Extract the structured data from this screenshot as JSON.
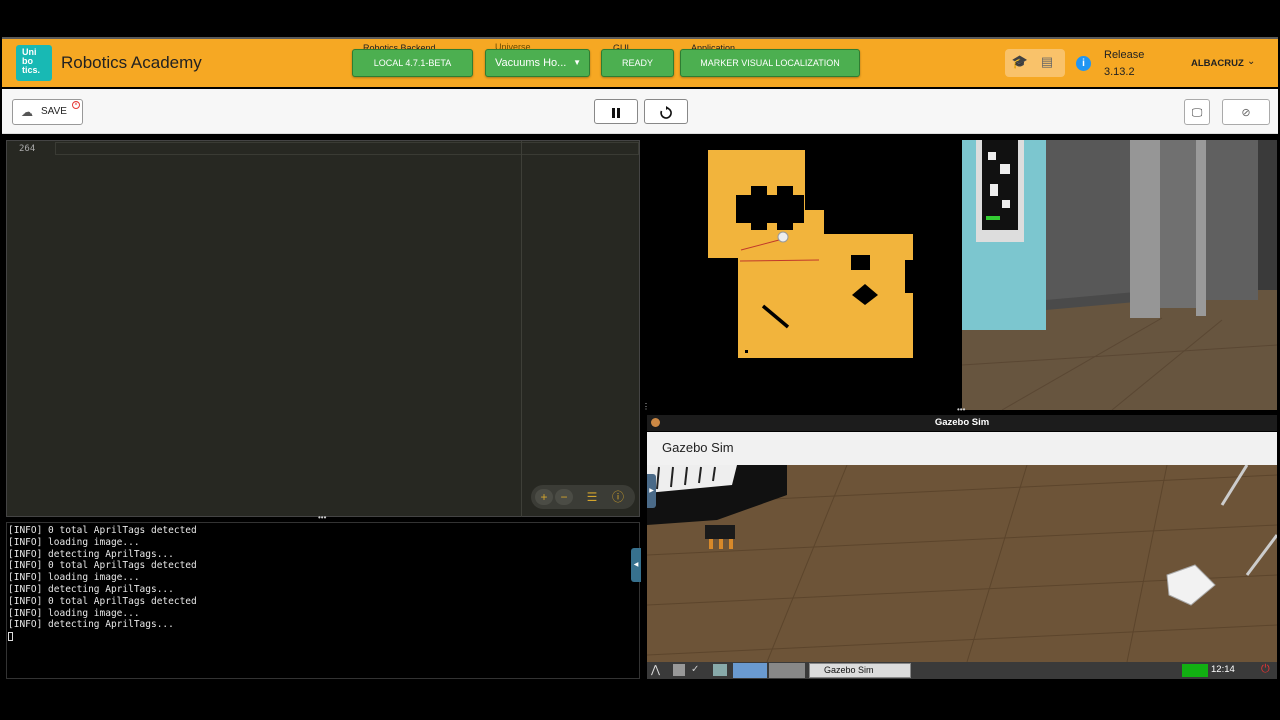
{
  "header": {
    "logo_lines": [
      "Uni",
      "bo",
      "tics."
    ],
    "app_title": "Robotics Academy",
    "backend_caption": "Robotics Backend",
    "backend_value": "LOCAL 4.7.1-BETA",
    "universe_caption": "Universe",
    "universe_value": "Vacuums Ho...",
    "gui_caption": "GUI",
    "gui_value": "READY",
    "application_caption": "Application",
    "application_value": "MARKER VISUAL LOCALIZATION",
    "release_label": "Release",
    "release_version": "3.13.2",
    "user_name": "ALBACRUZ"
  },
  "toolbar": {
    "save_label": "SAVE"
  },
  "editor": {
    "line_number": "264"
  },
  "console": {
    "lines": [
      "[INFO] 0 total AprilTags detected",
      "[INFO] loading image...",
      "[INFO] detecting AprilTags...",
      "[INFO] 0 total AprilTags detected",
      "[INFO] loading image...",
      "[INFO] detecting AprilTags...",
      "[INFO] 0 total AprilTags detected",
      "[INFO] loading image...",
      "[INFO] detecting AprilTags..."
    ]
  },
  "gazebo": {
    "window_title": "Gazebo Sim",
    "header_title": "Gazebo Sim",
    "task_label": "Gazebo Sim",
    "clock": "12:14"
  },
  "colors": {
    "header_bg": "#f6a823",
    "status_green": "#4caf50",
    "logo_teal": "#18b9b4",
    "editor_bg": "#272822",
    "map_floor": "#f2b43c"
  }
}
